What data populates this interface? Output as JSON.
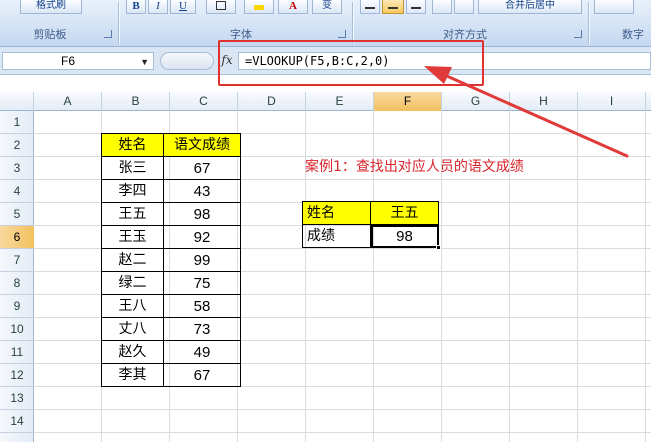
{
  "ribbon": {
    "paste_label": "格式刷",
    "bold_label": "B",
    "italic_label": "I",
    "underline_label": "U",
    "fontcolor_label": "A",
    "phonetic_label": "变",
    "merge_label": "合并后居中",
    "groups": {
      "clipboard": "剪贴板",
      "font": "字体",
      "alignment": "对齐方式",
      "number": "数字"
    }
  },
  "formula_bar": {
    "name_box": "F6",
    "fx": "fx",
    "formula": "=VLOOKUP(F5,B:C,2,0)"
  },
  "columns": [
    "A",
    "B",
    "C",
    "D",
    "E",
    "F",
    "G",
    "H",
    "I"
  ],
  "rows": [
    "1",
    "2",
    "3",
    "4",
    "5",
    "6",
    "7",
    "8",
    "9",
    "10",
    "11",
    "12",
    "13",
    "14"
  ],
  "source_table": {
    "headers": [
      "姓名",
      "语文成绩"
    ],
    "rows": [
      [
        "张三",
        "67"
      ],
      [
        "李四",
        "43"
      ],
      [
        "王五",
        "98"
      ],
      [
        "王玉",
        "92"
      ],
      [
        "赵二",
        "99"
      ],
      [
        "绿二",
        "75"
      ],
      [
        "王八",
        "58"
      ],
      [
        "丈八",
        "73"
      ],
      [
        "赵久",
        "49"
      ],
      [
        "李其",
        "67"
      ]
    ]
  },
  "lookup_table": {
    "label1": "姓名",
    "value1": "王五",
    "label2": "成绩",
    "value2": "98"
  },
  "annotation": "案例1：查找出对应人员的语文成绩",
  "colors": {
    "header_fill": "#ffff00",
    "annotation": "#d8242a",
    "selection": "#f1c15f"
  }
}
